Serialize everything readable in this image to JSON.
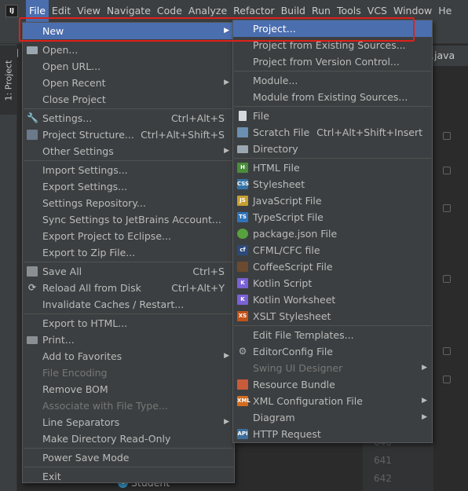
{
  "menubar": {
    "logo": "IJ",
    "items": [
      "File",
      "Edit",
      "View",
      "Navigate",
      "Code",
      "Analyze",
      "Refactor",
      "Build",
      "Run",
      "Tools",
      "VCS",
      "Window",
      "He"
    ]
  },
  "sidebar": {
    "project_tab": "1: Project"
  },
  "editor": {
    "tab_label": ".java",
    "line_numbers": [
      "640",
      "641",
      "642"
    ]
  },
  "tree": {
    "student": "Student"
  },
  "file_menu": {
    "new": "New",
    "open": "Open...",
    "open_url": "Open URL...",
    "open_recent": "Open Recent",
    "close_project": "Close Project",
    "settings": "Settings...",
    "settings_sc": "Ctrl+Alt+S",
    "project_structure": "Project Structure...",
    "project_structure_sc": "Ctrl+Alt+Shift+S",
    "other_settings": "Other Settings",
    "import_settings": "Import Settings...",
    "export_settings": "Export Settings...",
    "settings_repository": "Settings Repository...",
    "sync_settings": "Sync Settings to JetBrains Account...",
    "export_eclipse": "Export Project to Eclipse...",
    "export_zip": "Export to Zip File...",
    "save_all": "Save All",
    "save_all_sc": "Ctrl+S",
    "reload": "Reload All from Disk",
    "reload_sc": "Ctrl+Alt+Y",
    "invalidate": "Invalidate Caches / Restart...",
    "export_html": "Export to HTML...",
    "print": "Print...",
    "add_favorites": "Add to Favorites",
    "file_encoding": "File Encoding",
    "remove_bom": "Remove BOM",
    "associate": "Associate with File Type...",
    "line_separators": "Line Separators",
    "make_readonly": "Make Directory Read-Only",
    "power_save": "Power Save Mode",
    "exit": "Exit"
  },
  "new_menu": {
    "project": "Project...",
    "project_existing": "Project from Existing Sources...",
    "project_vcs": "Project from Version Control...",
    "module": "Module...",
    "module_existing": "Module from Existing Sources...",
    "file": "File",
    "scratch": "Scratch File",
    "scratch_sc": "Ctrl+Alt+Shift+Insert",
    "directory": "Directory",
    "html": "HTML File",
    "stylesheet": "Stylesheet",
    "javascript": "JavaScript File",
    "typescript": "TypeScript File",
    "package_json": "package.json File",
    "cfml": "CFML/CFC file",
    "coffeescript": "CoffeeScript File",
    "kotlin_script": "Kotlin Script",
    "kotlin_worksheet": "Kotlin Worksheet",
    "xslt": "XSLT Stylesheet",
    "edit_templates": "Edit File Templates...",
    "editorconfig": "EditorConfig File",
    "swing": "Swing UI Designer",
    "resource_bundle": "Resource Bundle",
    "xml_config": "XML Configuration File",
    "diagram": "Diagram",
    "http_request": "HTTP Request"
  },
  "icons": {
    "html": "H",
    "css": "CSS",
    "js": "JS",
    "ts": "TS",
    "cfml": "cf",
    "kotlin": "K",
    "xslt": "XS",
    "xml": "XML",
    "api": "API",
    "class": "c"
  },
  "colors": {
    "menu_bg": "#3c3f41",
    "selection": "#4b6eaf",
    "highlight_box": "#e0201a"
  }
}
